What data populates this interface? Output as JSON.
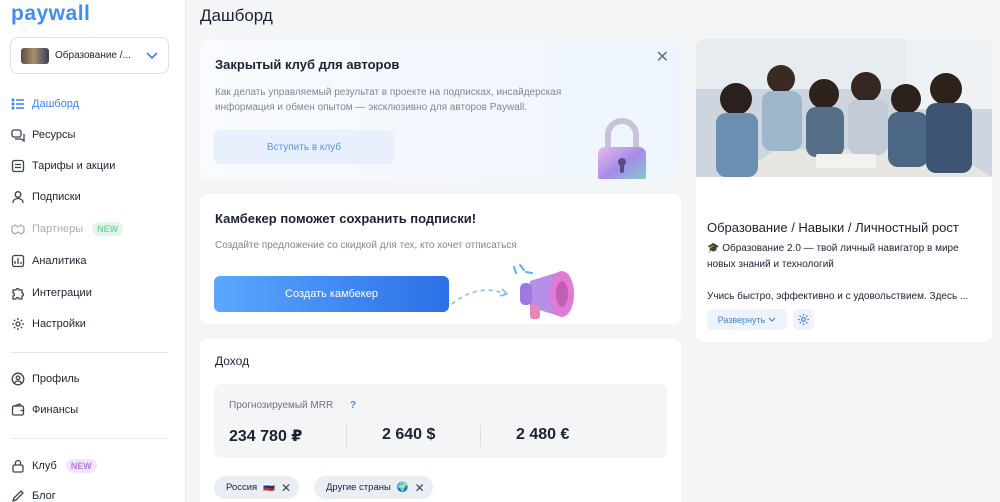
{
  "app": {
    "logo": "paywall"
  },
  "sidebar": {
    "project": {
      "name": "Образование /..."
    },
    "items": [
      {
        "label": "Дашборд"
      },
      {
        "label": "Ресурсы"
      },
      {
        "label": "Тарифы и акции"
      },
      {
        "label": "Подписки"
      },
      {
        "label": "Партнеры",
        "badge": "NEW"
      },
      {
        "label": "Аналитика"
      },
      {
        "label": "Интеграции"
      },
      {
        "label": "Настройки"
      }
    ],
    "items2": [
      {
        "label": "Профиль"
      },
      {
        "label": "Финансы"
      }
    ],
    "items3": [
      {
        "label": "Клуб",
        "badge": "NEW"
      },
      {
        "label": "Блог"
      }
    ]
  },
  "page": {
    "title": "Дашборд"
  },
  "club_card": {
    "title": "Закрытый клуб для авторов",
    "text": "Как делать управляемый результат в проекте на подписках, инсайдерская информация и обмен опытом — эксклюзивно для авторов Paywall.",
    "button": "Вступить в клуб"
  },
  "comeback_card": {
    "title": "Камбекер поможет сохранить подписки!",
    "text": "Создайте предложение со скидкой для тех, кто хочет отписаться",
    "button": "Создать камбекер"
  },
  "income": {
    "title": "Доход",
    "mrr_label": "Прогнозируемый MRR",
    "mrr_help": "?",
    "values": [
      "234 780 ₽",
      "2 640 $",
      "2 480 €"
    ],
    "chips": [
      {
        "label": "Россия",
        "flag": "🇷🇺"
      },
      {
        "label": "Другие страны",
        "flag": "🌍"
      }
    ]
  },
  "project_card": {
    "title": "Образование / Навыки / Личностный рост",
    "description": "🎓 Образование 2.0 — твой личный навигатор в мире новых знаний и технологий",
    "description2": "Учись быстро, эффективно и с удовольствием. Здесь ...",
    "expand": "Развернуть"
  },
  "colors": {
    "accent": "#3b82f6",
    "primary_button": "#2b6fe6",
    "badge_green": "#7fd3a5",
    "badge_pink": "#b37be0"
  }
}
